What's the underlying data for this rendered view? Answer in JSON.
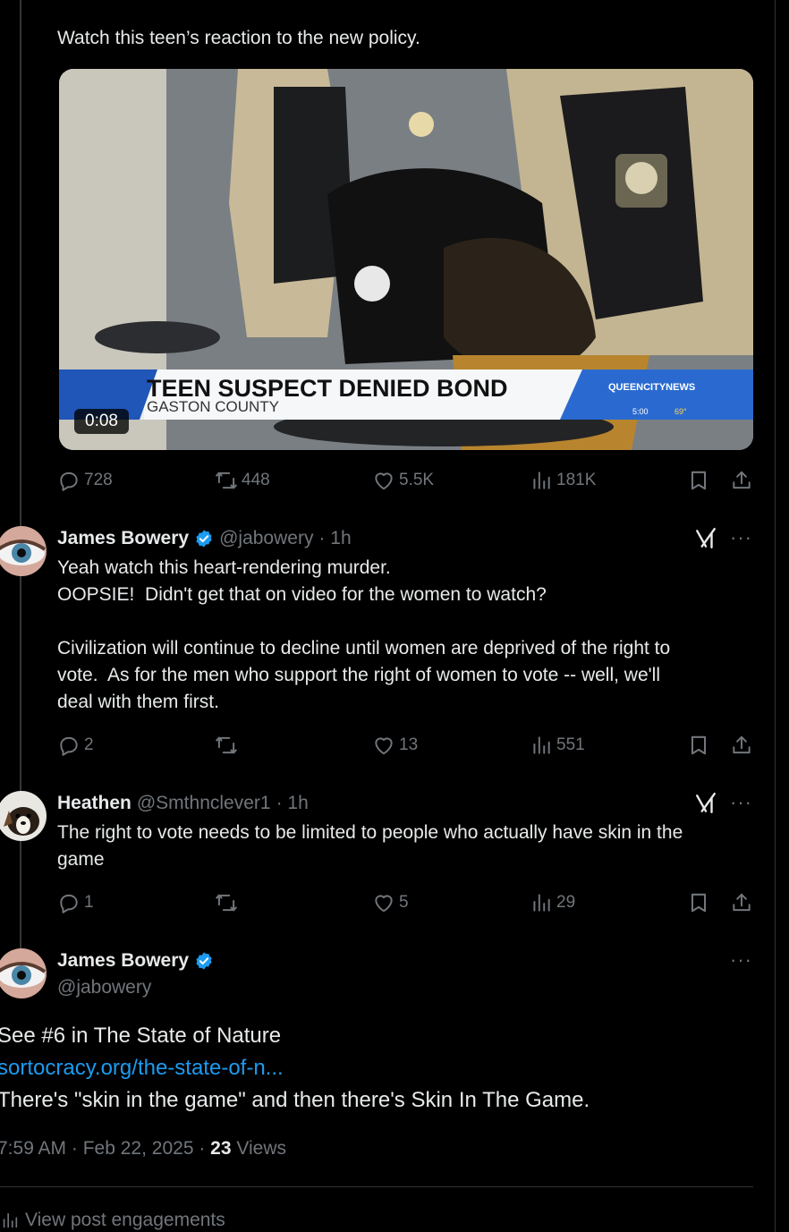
{
  "post": {
    "text": "Watch this teen’s reaction to the new policy.",
    "video": {
      "duration": "0:08",
      "headline": "TEEN SUSPECT DENIED BOND",
      "subheadline": "GASTON COUNTY",
      "network_logo": "QUEENCITYNEWS",
      "ticker_time": "5:00",
      "ticker_temp": "69°"
    },
    "actions": {
      "replies": "728",
      "reposts": "448",
      "likes": "5.5K",
      "views": "181K"
    }
  },
  "replies": [
    {
      "name": "James Bowery",
      "verified": true,
      "handle": "@jabowery",
      "time": "· 1h",
      "lines": [
        "Yeah watch this heart-rendering murder.",
        "OOPSIE!  Didn't get that on video for the women to watch?",
        "",
        "Civilization will continue to decline until women are deprived of the right to",
        "vote.  As for the men who support the right of women to vote -- well, we'll",
        "deal with them first."
      ],
      "actions": {
        "replies": "2",
        "reposts": "",
        "likes": "13",
        "views": "551"
      }
    },
    {
      "name": "Heathen",
      "verified": false,
      "handle": "@Smthnclever1",
      "time": "· 1h",
      "lines": [
        "The right to vote needs to be limited to people who actually have skin in the",
        "game"
      ],
      "actions": {
        "replies": "1",
        "reposts": "",
        "likes": "5",
        "views": "29"
      }
    }
  ],
  "main": {
    "name": "James Bowery",
    "handle": "@jabowery",
    "line1": "See #6 in The State of Nature",
    "link": "sortocracy.org/the-state-of-n...",
    "line3": "There's \"skin in the game\" and then there's Skin In The Game.",
    "time": "7:59 AM",
    "date": "Feb 22, 2025",
    "views_count": "23",
    "views_label": "Views",
    "engagements": "View post engagements"
  },
  "colors": {
    "accent": "#1d9bf0",
    "muted": "#71767b",
    "background": "#000000"
  }
}
